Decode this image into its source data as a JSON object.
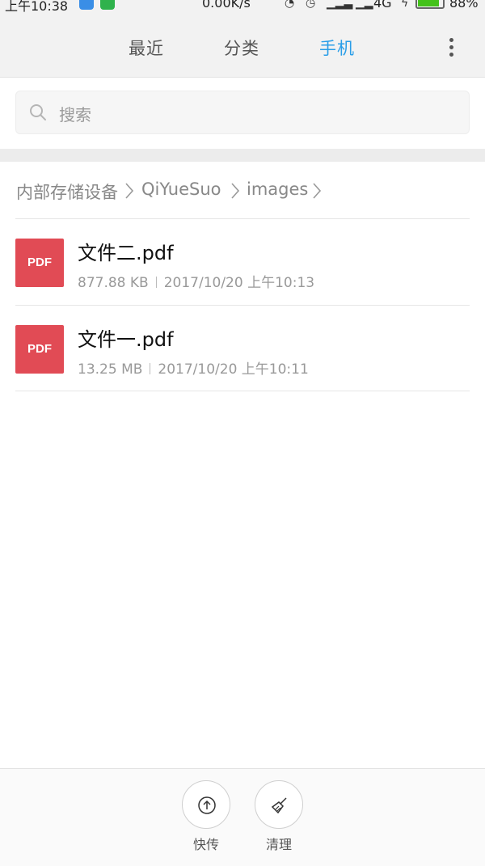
{
  "status_bar": {
    "time": "上午10:38",
    "speed": "0.00K/s",
    "network": "4G",
    "battery": "88%",
    "colors": {
      "battery_fill": "#44c21a",
      "usb_app": "#3a8ee6",
      "chat_app": "#2fb24c"
    }
  },
  "tabs": [
    {
      "label": "最近",
      "active": false
    },
    {
      "label": "分类",
      "active": false
    },
    {
      "label": "手机",
      "active": true
    }
  ],
  "accent_color": "#2a9ee8",
  "search": {
    "placeholder": "搜索"
  },
  "breadcrumb": [
    "内部存储设备",
    "QiYueSuo",
    "images"
  ],
  "files": [
    {
      "icon_label": "PDF",
      "name": "文件二.pdf",
      "size": "877.88 KB",
      "date": "2017/10/20 上午10:13"
    },
    {
      "icon_label": "PDF",
      "name": "文件一.pdf",
      "size": "13.25 MB",
      "date": "2017/10/20 上午10:11"
    }
  ],
  "file_icon_color": "#e14b55",
  "bottom_actions": [
    {
      "label": "快传",
      "icon": "upload-circle-icon"
    },
    {
      "label": "清理",
      "icon": "broom-icon"
    }
  ]
}
